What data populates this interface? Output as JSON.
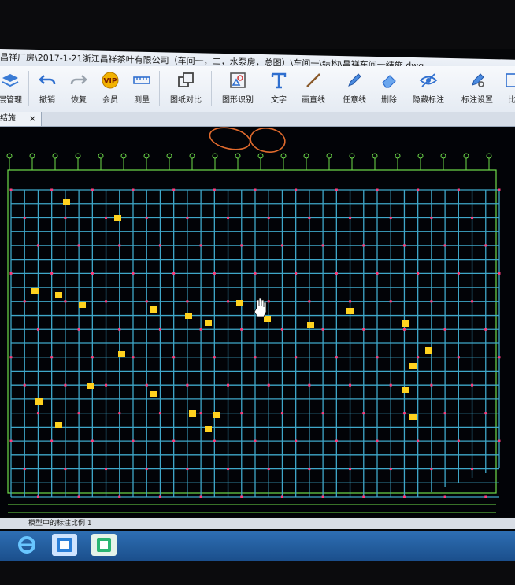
{
  "window": {
    "title": "昌祥厂房\\2017-1-21浙江昌祥茶叶有限公司（车间一，二，水泵房，总图）\\车间一\\结构\\昌祥车间一结施.dwg"
  },
  "toolbar": {
    "items": [
      {
        "label": "层管理",
        "icon": "layers-icon"
      },
      {
        "label": "撤销",
        "icon": "undo-icon"
      },
      {
        "label": "恢复",
        "icon": "redo-icon"
      },
      {
        "label": "会员",
        "icon": "vip-icon"
      },
      {
        "label": "测量",
        "icon": "ruler-icon"
      },
      {
        "label": "图纸对比",
        "icon": "compare-icon"
      },
      {
        "label": "图形识别",
        "icon": "shape-recognize-icon"
      },
      {
        "label": "文字",
        "icon": "text-icon"
      },
      {
        "label": "画直线",
        "icon": "line-icon"
      },
      {
        "label": "任意线",
        "icon": "pen-icon"
      },
      {
        "label": "删除",
        "icon": "eraser-icon"
      },
      {
        "label": "隐藏标注",
        "icon": "hide-eye-icon"
      },
      {
        "label": "标注设置",
        "icon": "annotation-settings-icon"
      },
      {
        "label": "比",
        "icon": "scale-icon"
      }
    ]
  },
  "tabs": [
    {
      "label": "结施",
      "close": "×"
    }
  ],
  "status": {
    "text": "模型中的标注比例 1"
  },
  "colors": {
    "grid_lines": "#3fa7c9",
    "axis_lines": "#6fdc4a",
    "markers": "#ff3d7d",
    "labels": "#ffd21f",
    "annotation_circle": "#e06a2d"
  }
}
